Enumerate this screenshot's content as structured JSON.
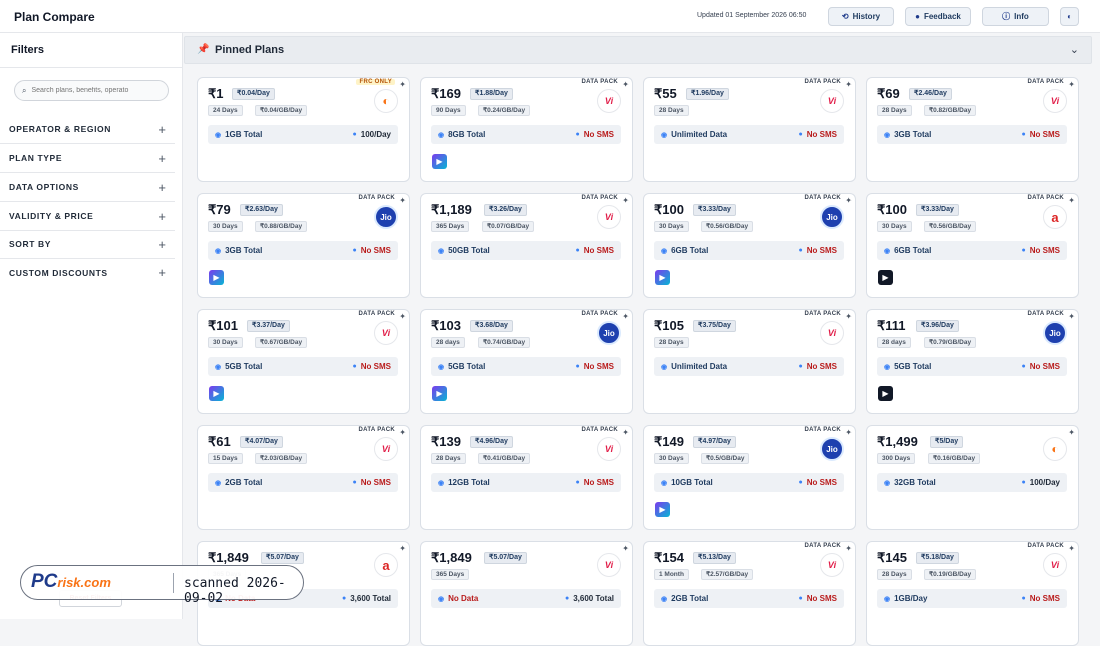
{
  "header": {
    "title": "Plan Compare",
    "updated": "Updated 01 September 2026 06:50",
    "history_label": "History",
    "feedback_label": "Feedback",
    "info_label": "Info"
  },
  "sidebar": {
    "title": "Filters",
    "search_placeholder": "Search plans, benefits, operato",
    "facets": [
      "OPERATOR & REGION",
      "PLAN TYPE",
      "DATA OPTIONS",
      "VALIDITY & PRICE",
      "SORT BY",
      "CUSTOM DISCOUNTS"
    ],
    "reset_label": "Reset Filters"
  },
  "pinned": {
    "label": "Pinned Plans"
  },
  "plans": [
    {
      "price": "₹1",
      "perday": "₹0.04/Day",
      "tag": "FRC ONLY",
      "op": "bsnl",
      "days": "24 Days",
      "pergb": "₹0.04/GB/Day",
      "data": "1GB Total",
      "sms": "100/Day",
      "ott": ""
    },
    {
      "price": "₹169",
      "perday": "₹1.88/Day",
      "tag": "DATA PACK",
      "op": "vi",
      "days": "90 Days",
      "pergb": "₹0.24/GB/Day",
      "data": "8GB Total",
      "sms": "No SMS",
      "ott": "blue"
    },
    {
      "price": "₹55",
      "perday": "₹1.96/Day",
      "tag": "DATA PACK",
      "op": "vi",
      "days": "28 Days",
      "pergb": "",
      "data": "Unlimited Data",
      "sms": "No SMS",
      "ott": ""
    },
    {
      "price": "₹69",
      "perday": "₹2.46/Day",
      "tag": "DATA PACK",
      "op": "vi",
      "days": "28 Days",
      "pergb": "₹0.82/GB/Day",
      "data": "3GB Total",
      "sms": "No SMS",
      "ott": ""
    },
    {
      "price": "₹79",
      "perday": "₹2.63/Day",
      "tag": "DATA PACK",
      "op": "jio",
      "days": "30 Days",
      "pergb": "₹0.88/GB/Day",
      "data": "3GB Total",
      "sms": "No SMS",
      "ott": "blue"
    },
    {
      "price": "₹1,189",
      "perday": "₹3.26/Day",
      "tag": "DATA PACK",
      "op": "vi",
      "days": "365 Days",
      "pergb": "₹0.07/GB/Day",
      "data": "50GB Total",
      "sms": "No SMS",
      "ott": ""
    },
    {
      "price": "₹100",
      "perday": "₹3.33/Day",
      "tag": "DATA PACK",
      "op": "jio",
      "days": "30 Days",
      "pergb": "₹0.56/GB/Day",
      "data": "6GB Total",
      "sms": "No SMS",
      "ott": "blue"
    },
    {
      "price": "₹100",
      "perday": "₹3.33/Day",
      "tag": "DATA PACK",
      "op": "airtel",
      "days": "30 Days",
      "pergb": "₹0.56/GB/Day",
      "data": "6GB Total",
      "sms": "No SMS",
      "ott": "dark"
    },
    {
      "price": "₹101",
      "perday": "₹3.37/Day",
      "tag": "DATA PACK",
      "op": "vi",
      "days": "30 Days",
      "pergb": "₹0.67/GB/Day",
      "data": "5GB Total",
      "sms": "No SMS",
      "ott": "blue"
    },
    {
      "price": "₹103",
      "perday": "₹3.68/Day",
      "tag": "DATA PACK",
      "op": "jio",
      "days": "28 days",
      "pergb": "₹0.74/GB/Day",
      "data": "5GB Total",
      "sms": "No SMS",
      "ott": "blue"
    },
    {
      "price": "₹105",
      "perday": "₹3.75/Day",
      "tag": "DATA PACK",
      "op": "vi",
      "days": "28 Days",
      "pergb": "",
      "data": "Unlimited Data",
      "sms": "No SMS",
      "ott": ""
    },
    {
      "price": "₹111",
      "perday": "₹3.96/Day",
      "tag": "DATA PACK",
      "op": "jio",
      "days": "28 days",
      "pergb": "₹0.79/GB/Day",
      "data": "5GB Total",
      "sms": "No SMS",
      "ott": "dark"
    },
    {
      "price": "₹61",
      "perday": "₹4.07/Day",
      "tag": "DATA PACK",
      "op": "vi",
      "days": "15 Days",
      "pergb": "₹2.03/GB/Day",
      "data": "2GB Total",
      "sms": "No SMS",
      "ott": ""
    },
    {
      "price": "₹139",
      "perday": "₹4.96/Day",
      "tag": "DATA PACK",
      "op": "vi",
      "days": "28 Days",
      "pergb": "₹0.41/GB/Day",
      "data": "12GB Total",
      "sms": "No SMS",
      "ott": ""
    },
    {
      "price": "₹149",
      "perday": "₹4.97/Day",
      "tag": "DATA PACK",
      "op": "jio",
      "days": "30 Days",
      "pergb": "₹0.5/GB/Day",
      "data": "10GB Total",
      "sms": "No SMS",
      "ott": "blue"
    },
    {
      "price": "₹1,499",
      "perday": "₹5/Day",
      "tag": "",
      "op": "bsnl",
      "days": "300 Days",
      "pergb": "₹0.16/GB/Day",
      "data": "32GB Total",
      "sms": "100/Day",
      "ott": ""
    },
    {
      "price": "₹1,849",
      "perday": "₹5.07/Day",
      "tag": "",
      "op": "airtel",
      "days": "365 Days",
      "pergb": "",
      "data": "No Data",
      "sms": "3,600 Total",
      "ott": ""
    },
    {
      "price": "₹1,849",
      "perday": "₹5.07/Day",
      "tag": "",
      "op": "vi",
      "days": "365 Days",
      "pergb": "",
      "data": "No Data",
      "sms": "3,600 Total",
      "ott": ""
    },
    {
      "price": "₹154",
      "perday": "₹5.13/Day",
      "tag": "DATA PACK",
      "op": "vi",
      "days": "1 Month",
      "pergb": "₹2.57/GB/Day",
      "data": "2GB Total",
      "sms": "No SMS",
      "ott": ""
    },
    {
      "price": "₹145",
      "perday": "₹5.18/Day",
      "tag": "DATA PACK",
      "op": "vi",
      "days": "28 Days",
      "pergb": "₹0.19/GB/Day",
      "data": "1GB/Day",
      "sms": "No SMS",
      "ott": ""
    }
  ],
  "logos": {
    "vi": "Vi",
    "jio": "Jio",
    "airtel": "a",
    "bsnl": "◐"
  },
  "watermark": {
    "logo": "PC",
    "logo_suffix": "risk.com",
    "text": "scanned 2026-09-02"
  },
  "colors": {
    "accent": "#1e3a8a",
    "no_sms": "#b91c1c",
    "jio": "#1e40af",
    "vi": "#e11d48",
    "airtel": "#dc2626"
  }
}
